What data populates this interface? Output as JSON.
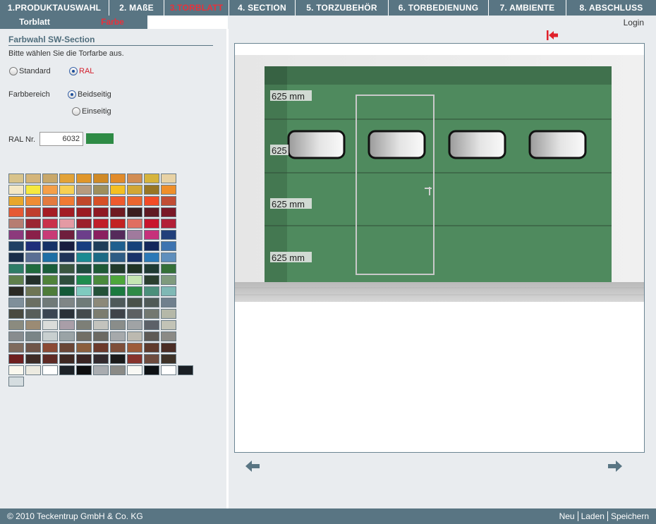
{
  "nav": {
    "steps": [
      {
        "label": "1.PRODUKTAUSWAHL",
        "active": false
      },
      {
        "label": "2. MAßE",
        "active": false
      },
      {
        "label": "3.TORBLATT",
        "active": true
      },
      {
        "label": "4. SECTION",
        "active": false
      },
      {
        "label": "5. TORZUBEHÖR",
        "active": false
      },
      {
        "label": "6. TORBEDIENUNG",
        "active": false
      },
      {
        "label": "7. AMBIENTE",
        "active": false
      },
      {
        "label": "8. ABSCHLUSS",
        "active": false
      }
    ]
  },
  "subtabs": {
    "torblatt": "Torblatt",
    "farbe": "Farbe"
  },
  "left": {
    "title": "Farbwahl SW-Section",
    "instruction": "Bitte wählen Sie die Torfarbe aus.",
    "option_standard": "Standard",
    "option_ral": "RAL",
    "farbbereich_label": "Farbbereich",
    "option_beidseitig": "Beidseitig",
    "option_einseitig": "Einseitig",
    "ral_label": "RAL Nr.",
    "ral_value": "6032",
    "ral_color": "#2e8b45",
    "palette": [
      [
        "#d8c38b",
        "#d4b57a",
        "#c9a86a",
        "#e2a237",
        "#e0962a",
        "#d08a26",
        "#e18b2a",
        "#d28d53",
        "#d6b43c",
        "#e8d2a4"
      ],
      [
        "#f4e7c4",
        "#f6e93f",
        "#f59f48",
        "#f7cf52",
        "#b79b7e",
        "#9f8f5c",
        "#f4bf22",
        "#d2a734",
        "#987625",
        "#ef8f2a"
      ],
      [
        "#e8a72c",
        "#ef8c34",
        "#e37a3f",
        "#f07a33",
        "#c0482c",
        "#d65029",
        "#ee5a2e",
        "#e9662f",
        "#f24b27",
        "#c14d35"
      ],
      [
        "#e55a34",
        "#bf3f2d",
        "#a51c24",
        "#a31d24",
        "#9b1b22",
        "#8f1a24",
        "#6f1a22",
        "#3a1e1f",
        "#5f1a23",
        "#7a1827"
      ],
      [
        "#b67d72",
        "#9b2532",
        "#c9314b",
        "#e49aa4",
        "#9c1f2c",
        "#c01f2a",
        "#c22323",
        "#e06e61",
        "#c8152d",
        "#b21f37"
      ],
      [
        "#8c3a7c",
        "#8a2049",
        "#c83b76",
        "#6f1f3d",
        "#6c3e8a",
        "#8a1f5f",
        "#552a5a",
        "#a07a9d",
        "#c6317b",
        "#213f7a"
      ],
      [
        "#1f3f63",
        "#1e2e7a",
        "#153267",
        "#191d3f",
        "#183e80",
        "#1f3e5a",
        "#1f5f8e",
        "#17427a",
        "#13275b",
        "#3d73b0"
      ],
      [
        "#192d4a",
        "#596e94",
        "#1d6fa5",
        "#1f3459",
        "#1a8a92",
        "#1c6a85",
        "#2e5c84",
        "#18336a",
        "#2b79b7",
        "#5f8fbd"
      ],
      [
        "#2e7c66",
        "#1f6b3d",
        "#1a5d3a",
        "#3a5640",
        "#1f4c3e",
        "#1e5a35",
        "#213a2a",
        "#203424",
        "#1f3a32",
        "#357038"
      ],
      [
        "#5f7f4c",
        "#23302b",
        "#50823a",
        "#2e4e3c",
        "#1e8c4e",
        "#4a8a3c",
        "#4da63a",
        "#c5e6b2",
        "#2a3e2e",
        "#7f9a7d"
      ],
      [
        "#2b2a24",
        "#6e7554",
        "#4e7c3a",
        "#145a38",
        "#7fcbbf",
        "#245238",
        "#1b7a3f",
        "#2f8a46",
        "#4b8f7b",
        "#7fb8b5"
      ],
      [
        "#7f8f9a",
        "#6b6f62",
        "#707a78",
        "#7f8686",
        "#6f7b78",
        "#8c8979",
        "#4e5a5a",
        "#49524a",
        "#4f5a57",
        "#70808d"
      ],
      [
        "#4a4a3f",
        "#585e5a",
        "#3b4552",
        "#2a3138",
        "#444a4c",
        "#7c7d6f",
        "#3f4349",
        "#5d6062",
        "#737870",
        "#b5b8a8"
      ],
      [
        "#8b8b7f",
        "#9b8b74",
        "#dadcda",
        "#a99ea8",
        "#7d7f77",
        "#c3c3bd",
        "#8a8d8a",
        "#a0a3a5",
        "#5c6168",
        "#c2c3b6"
      ],
      [
        "#888c8e",
        "#7a8587",
        "#c8cfd0",
        "#9aa3a6",
        "#726f66",
        "#6c6a63",
        "#a6a9ab",
        "#bcb9b0",
        "#5e5a55",
        "#8b8a86"
      ],
      [
        "#7f6b5e",
        "#6f5549",
        "#8b4a35",
        "#6a4636",
        "#8b5f3e",
        "#6c3a2c",
        "#7e4f3a",
        "#9d5c3a",
        "#5f3a2c",
        "#4a2d26"
      ],
      [
        "#6e1f1f",
        "#3d2b26",
        "#5e2a25",
        "#3e2822",
        "#3a2523",
        "#332a2e",
        "#1a1a1a",
        "#86332c",
        "#6e4c3f",
        "#3e3228"
      ],
      [
        "#fbf8ee",
        "#eceae0",
        "#ffffff",
        "#1d2227",
        "#0e0e0f",
        "#a9acb0",
        "#8a8a86",
        "#f8f8f4",
        "#0e1114",
        "#ffffff",
        "#1a1f24"
      ],
      [
        "#d5dde0"
      ]
    ]
  },
  "door": {
    "panel_label": "625 mm"
  },
  "top_right": {
    "login": "Login",
    "pin_icon": "pin-arrow-icon"
  },
  "arrows": {
    "prev": "arrow-left-icon",
    "next": "arrow-right-icon"
  },
  "footer": {
    "copyright": "© 2010 Teckentrup GmbH & Co. KG",
    "neu": "Neu",
    "laden": "Laden",
    "speichern": "Speichern"
  }
}
